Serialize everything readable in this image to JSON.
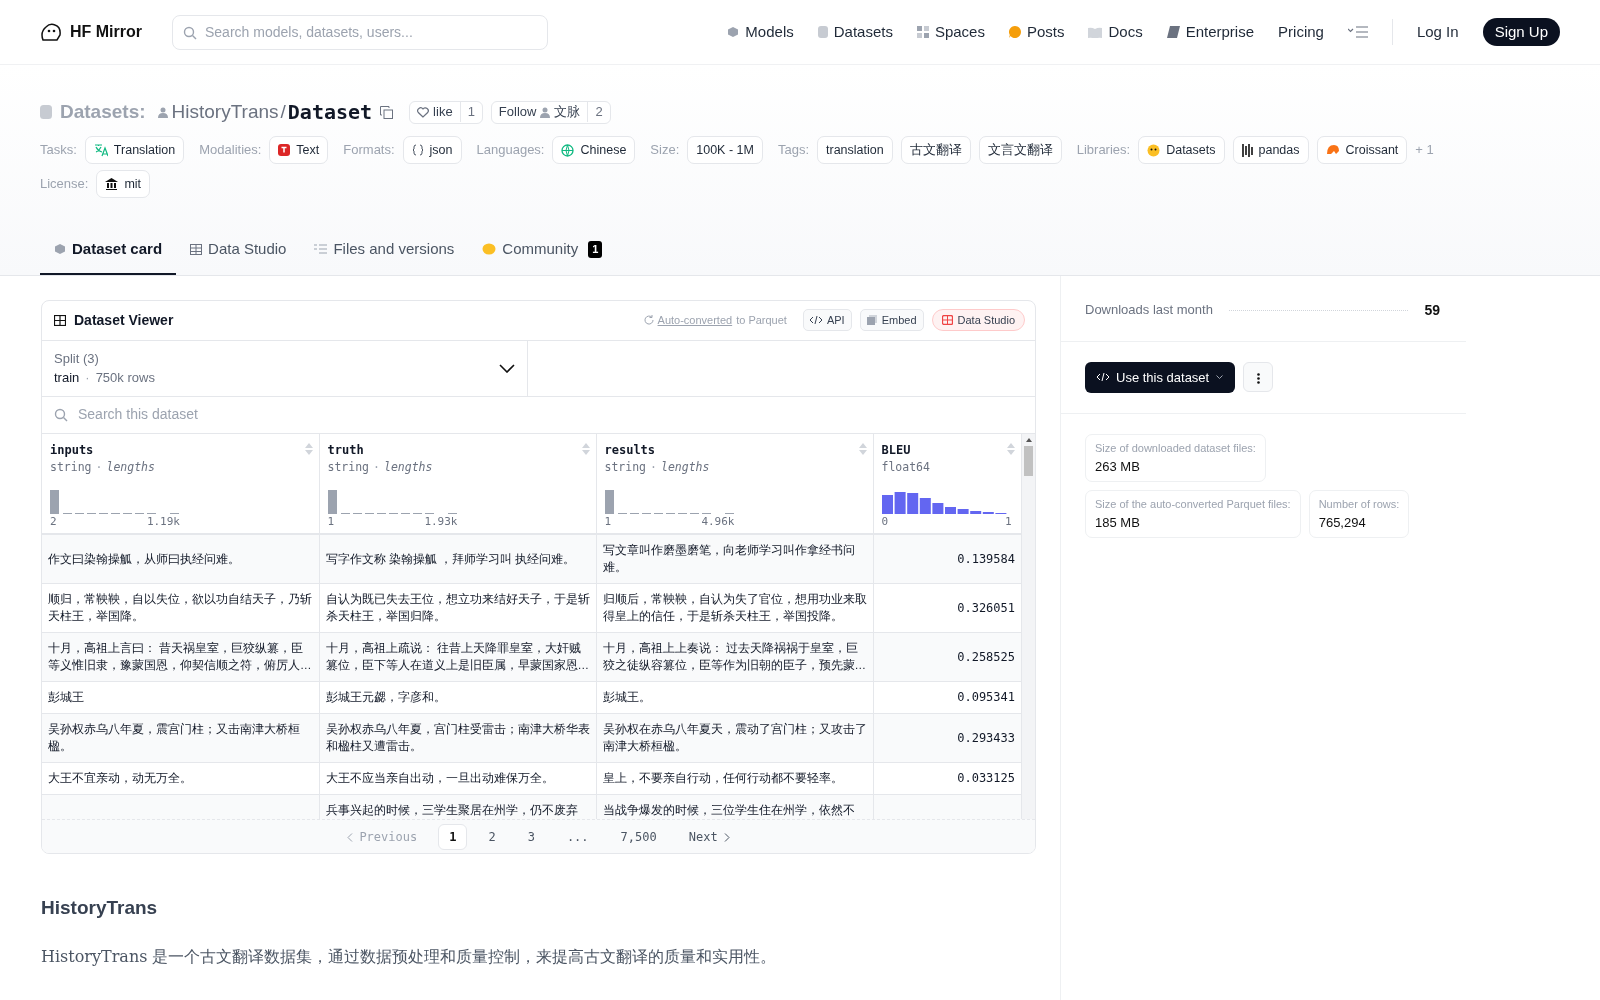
{
  "navbar": {
    "brand": "HF Mirror",
    "search": {
      "placeholder": "Search models, datasets, users..."
    },
    "links": [
      {
        "label": "Models"
      },
      {
        "label": "Datasets"
      },
      {
        "label": "Spaces"
      },
      {
        "label": "Posts"
      },
      {
        "label": "Docs"
      },
      {
        "label": "Enterprise"
      },
      {
        "label": "Pricing"
      }
    ],
    "login": "Log In",
    "signup": "Sign Up"
  },
  "header": {
    "category": "Datasets:",
    "owner": "HistoryTrans",
    "separator": "/",
    "name": "Dataset",
    "like": {
      "label": "like",
      "count": "1"
    },
    "follow": {
      "label": "Follow",
      "org": "文脉",
      "count": "2"
    }
  },
  "tag_groups": [
    {
      "label": "Tasks:",
      "items": [
        "Translation"
      ]
    },
    {
      "label": "Modalities:",
      "items": [
        "Text"
      ]
    },
    {
      "label": "Formats:",
      "items": [
        "json"
      ]
    },
    {
      "label": "Languages:",
      "items": [
        "Chinese"
      ]
    },
    {
      "label": "Size:",
      "items": [
        "100K - 1M"
      ]
    },
    {
      "label": "Tags:",
      "items": [
        "translation",
        "古文翻译",
        "文言文翻译"
      ]
    },
    {
      "label": "Libraries:",
      "items": [
        "Datasets",
        "pandas",
        "Croissant"
      ],
      "more": "+ 1"
    },
    {
      "label": "License:",
      "items": [
        "mit"
      ]
    }
  ],
  "tabs": [
    {
      "label": "Dataset card",
      "selected": true
    },
    {
      "label": "Data Studio",
      "selected": false
    },
    {
      "label": "Files and versions",
      "selected": false
    },
    {
      "label": "Community",
      "selected": false,
      "badge": "1"
    }
  ],
  "viewer": {
    "title": "Dataset Viewer",
    "converted_link": "Auto-converted",
    "converted_text": "to Parquet",
    "buttons": [
      "API",
      "Embed",
      "Data Studio"
    ],
    "split": {
      "label": "Split (3)",
      "name": "train",
      "separator": "·",
      "rows": "750k rows"
    },
    "search": {
      "placeholder": "Search this dataset"
    },
    "columns": [
      {
        "name": "inputs",
        "type": "string",
        "separator": "·",
        "stat": "lengths",
        "min": "2",
        "max": "1.19k"
      },
      {
        "name": "truth",
        "type": "string",
        "separator": "·",
        "stat": "lengths",
        "min": "1",
        "max": "1.93k"
      },
      {
        "name": "results",
        "type": "string",
        "separator": "·",
        "stat": "lengths",
        "min": "1",
        "max": "4.96k"
      },
      {
        "name": "BLEU",
        "type": "float64",
        "min": "0",
        "max": "1"
      }
    ],
    "rows": [
      [
        "作文曰染翰操觚，从师曰执经问难。",
        "写字作文称 染翰操觚 ，拜师学习叫 执经问难。",
        "写文章叫作磨墨磨笔，向老师学习叫作拿经书问难。",
        "0.139584"
      ],
      [
        "顺归，常鞅鞅，自以失位，欲以功自结天子，乃斩天柱王，举国降。",
        "自认为既已失去王位，想立功来结好天子，于是斩杀天柱王，举国归降。",
        "归顺后，常鞅鞅，自认为失了官位，想用功业来取得皇上的信任，于是斩杀天柱王，举国投降。",
        "0.326051"
      ],
      [
        "十月，高祖上言曰： 昔天祸皇室，巨狡纵篡，臣等义惟旧隶，豫蒙国恩，仰契信顺之符，俯厉人…",
        "十月，高祖上疏说： 往昔上天降罪皇室，大奸贼篡位，臣下等人在道义上是旧臣属，早蒙国家恩…",
        "十月，高祖上上奏说： 过去天降祸祸于皇室，巨狡之徒纵容篡位，臣等作为旧朝的臣子，预先蒙…",
        "0.258525"
      ],
      [
        "彭城王",
        "彭城王元勰，字彦和。",
        "彭城王。",
        "0.095341"
      ],
      [
        "吴孙权赤乌八年夏，震宫门柱；又击南津大桥桓楹。",
        "吴孙权赤乌八年夏，宫门柱受雷击；南津大桥华表和楹柱又遭雷击。",
        "吴孙权在赤乌八年夏天，震动了宫门柱；又攻击了南津大桥桓楹。",
        "0.293433"
      ],
      [
        "大王不宜亲动，动无万全。",
        "大王不应当亲自出动，一旦出动难保万全。",
        "皇上，不要亲自行动，任何行动都不要轻率。",
        "0.033125"
      ],
      [
        null,
        "兵事兴起的时候，三学生聚居在州学，仍不废弃",
        "当战争爆发的时候，三位学生住在州学，依然不",
        null
      ]
    ],
    "pagination": {
      "previous": "Previous",
      "pages": [
        {
          "label": "1",
          "selected": true
        },
        {
          "label": "2",
          "selected": false
        },
        {
          "label": "3",
          "selected": false
        },
        {
          "label": "...",
          "selected": false
        },
        {
          "label": "7,500",
          "selected": false
        }
      ],
      "next": "Next"
    }
  },
  "sidebar": {
    "downloads_label": "Downloads last month",
    "downloads": "59",
    "use_button": "Use this dataset",
    "stats": [
      {
        "label": "Size of downloaded dataset files:",
        "value": "263 MB"
      },
      {
        "label": "Size of the auto-converted Parquet files:",
        "value": "185 MB"
      },
      {
        "label": "Number of rows:",
        "value": "765,294"
      }
    ]
  },
  "card": {
    "heading": "HistoryTrans",
    "paragraph": "HistoryTrans 是一个古文翻译数据集，通过数据预处理和质量控制，来提高古文翻译的质量和实用性。"
  }
}
